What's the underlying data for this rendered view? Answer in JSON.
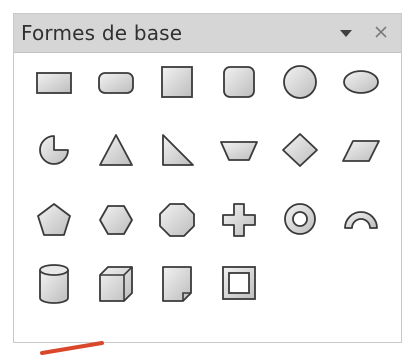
{
  "panel": {
    "title": "Formes de base",
    "menu_icon": "dropdown-triangle-icon",
    "close_icon": "close-icon"
  },
  "shapes": [
    "rectangle",
    "rounded-rectangle",
    "square",
    "rounded-square",
    "circle",
    "ellipse",
    "circle-pie",
    "isosceles-triangle",
    "right-triangle",
    "trapezoid",
    "diamond",
    "parallelogram",
    "pentagon",
    "hexagon",
    "octagon",
    "cross",
    "ring",
    "block-arc",
    "cylinder",
    "cube",
    "folded-corner",
    "frame"
  ],
  "colors": {
    "titlebar": "#d6d6d6",
    "shape_fill_light": "#f0f0f0",
    "shape_fill_dark": "#c6c6c6",
    "shape_stroke": "#3a3a3a",
    "accent_pointer": "#d9482b"
  }
}
